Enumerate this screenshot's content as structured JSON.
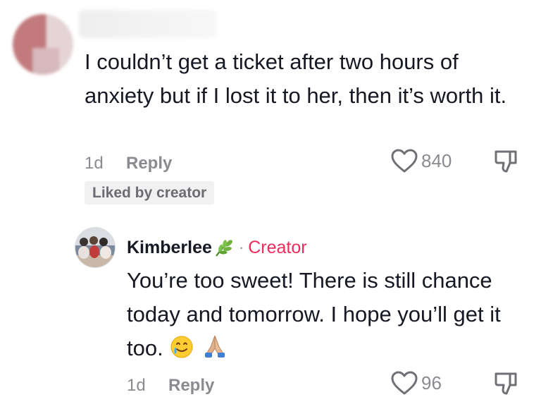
{
  "comment": {
    "text": "I couldn’t get a ticket after two hours of anxiety but if I lost it to her, then it’s worth it.",
    "time": "1d",
    "reply_label": "Reply",
    "likes": "840",
    "liked_badge": "Liked by creator"
  },
  "reply": {
    "author": "Kimberlee",
    "separator": "·",
    "badge": "Creator",
    "text": "You’re too sweet! There is still chance today and tomorrow. I hope you’ll get it too.",
    "time": "1d",
    "reply_label": "Reply",
    "likes": "96"
  },
  "icons": {
    "like": "heart-outline-icon",
    "dislike": "thumbs-down-icon",
    "author_flair": "leaf-icon",
    "emoji_1": "smiling-face-with-tear-emoji",
    "emoji_2": "folded-hands-emoji"
  },
  "colors": {
    "text": "#161823",
    "muted": "#8a8b91",
    "creator": "#f02c5c",
    "badge_bg": "#f1f1f2"
  }
}
